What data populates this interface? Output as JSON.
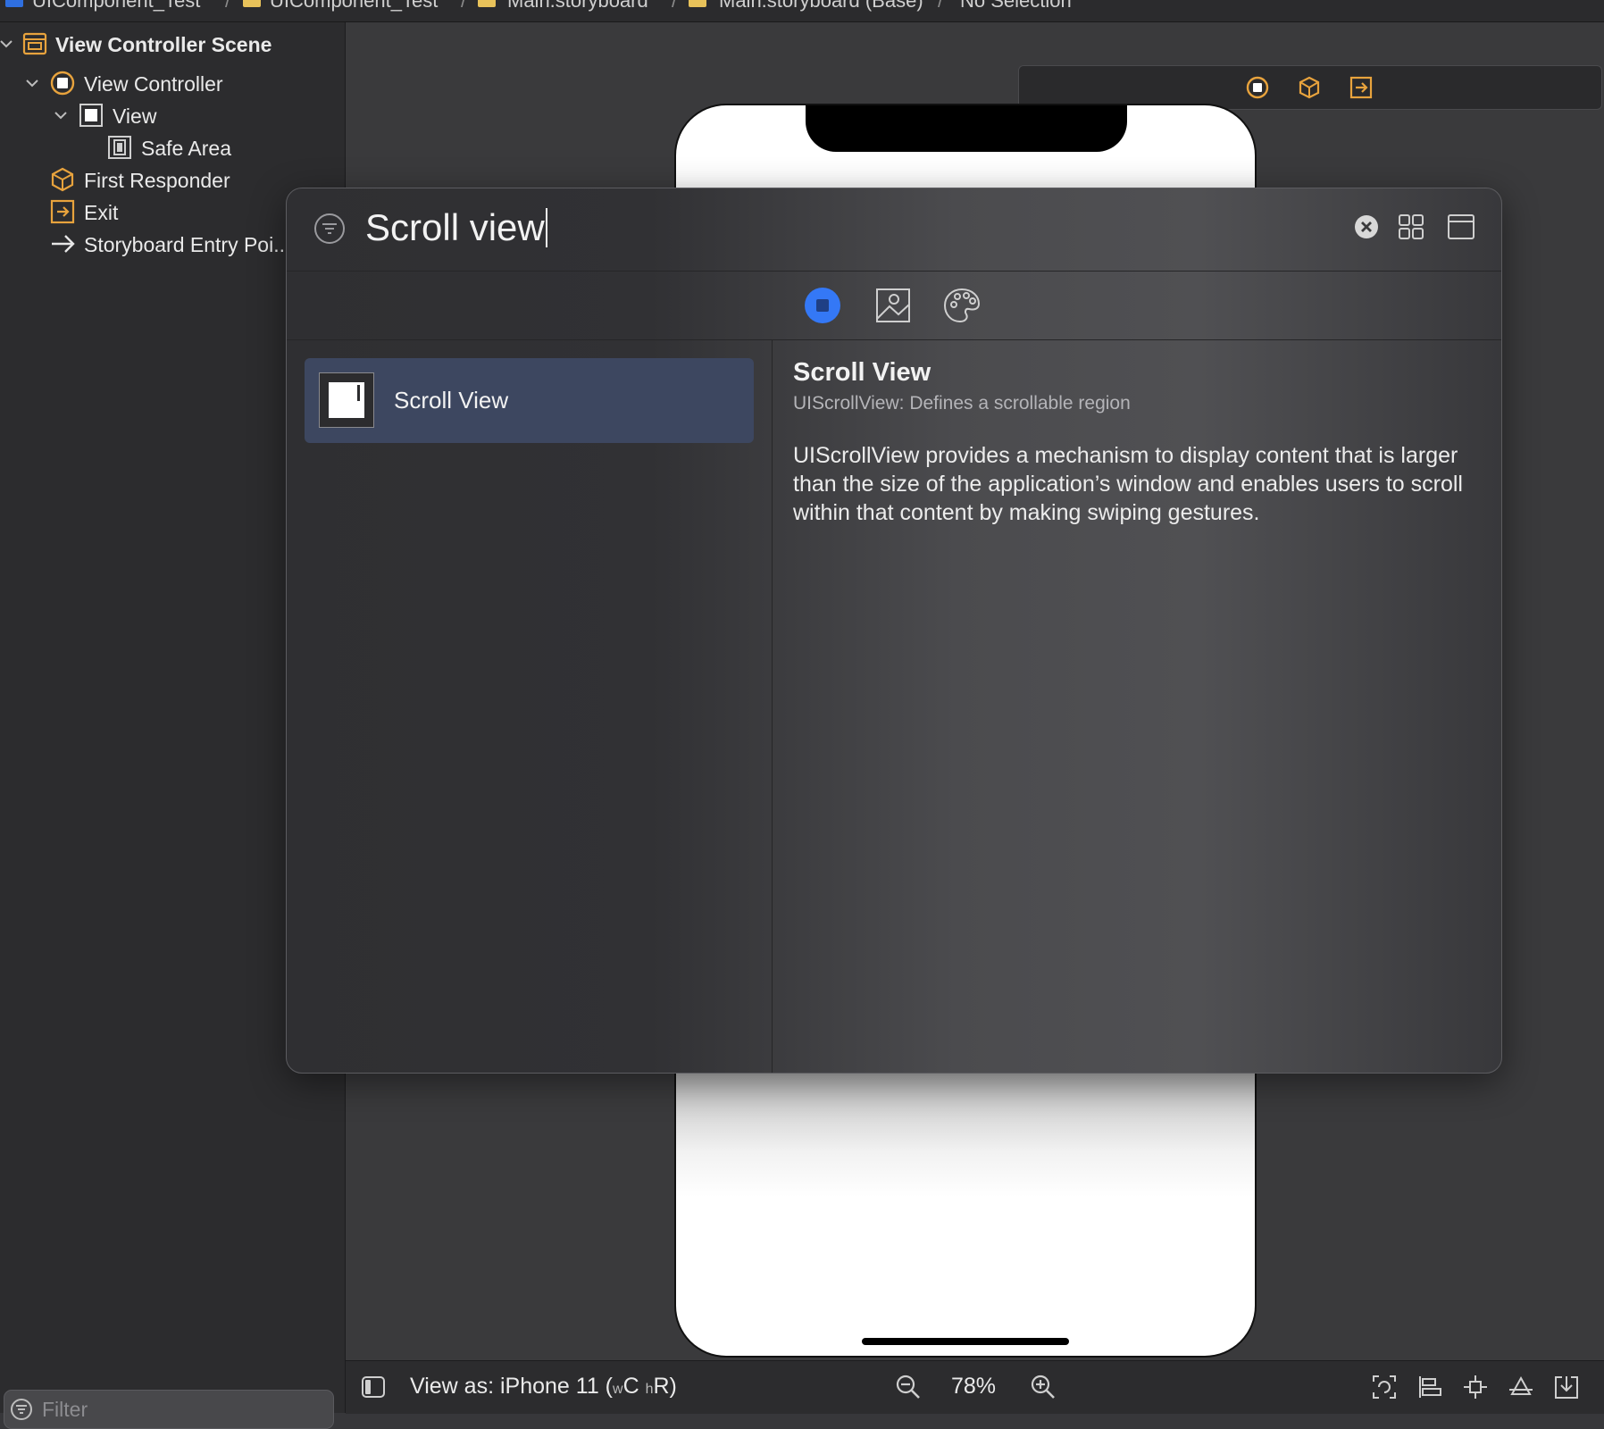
{
  "breadcrumb": {
    "items": [
      "UIComponent_Test",
      "UIComponent_Test",
      "Main.storyboard",
      "Main.storyboard (Base)",
      "No Selection"
    ],
    "separator": "/"
  },
  "outline": {
    "rows": [
      {
        "label": "View Controller Scene",
        "icon": "scene-icon",
        "expanded": true
      },
      {
        "label": "View Controller",
        "icon": "view-controller-icon",
        "expanded": true
      },
      {
        "label": "View",
        "icon": "view-icon",
        "expanded": true
      },
      {
        "label": "Safe Area",
        "icon": "safe-area-icon"
      },
      {
        "label": "First Responder",
        "icon": "first-responder-icon"
      },
      {
        "label": "Exit",
        "icon": "exit-icon"
      },
      {
        "label": "Storyboard Entry Poi...",
        "icon": "entry-arrow-icon"
      }
    ],
    "filter_placeholder": "Filter"
  },
  "canvas": {
    "dock_icons": [
      "view-controller-icon",
      "first-responder-icon",
      "exit-icon"
    ],
    "device": "iPhone 11"
  },
  "library": {
    "search_query": "Scroll view",
    "buttons": [
      "clear-search-icon",
      "grid-view-icon",
      "window-icon"
    ],
    "tabs": [
      {
        "name": "objects-tab",
        "selected": true
      },
      {
        "name": "media-tab",
        "selected": false
      },
      {
        "name": "colors-tab",
        "selected": false
      }
    ],
    "results": [
      {
        "label": "Scroll View",
        "selected": true
      }
    ],
    "detail": {
      "title": "Scroll View",
      "subtitle": "UIScrollView: Defines a scrollable region",
      "description": "UIScrollView provides a mechanism to display content that is larger than the size of the application’s window and enables users to scroll within that content by making swiping gestures."
    }
  },
  "bottom_bar": {
    "view_as_prefix": "View as: iPhone 11 (",
    "w_small": "w",
    "w_class": "C",
    "h_small": "h",
    "h_class": "R",
    "view_as_suffix": ")",
    "zoom": "78%"
  },
  "colors": {
    "accent": "#3478f6",
    "object_orange": "#e8a33d",
    "selection": "#3d4760"
  }
}
